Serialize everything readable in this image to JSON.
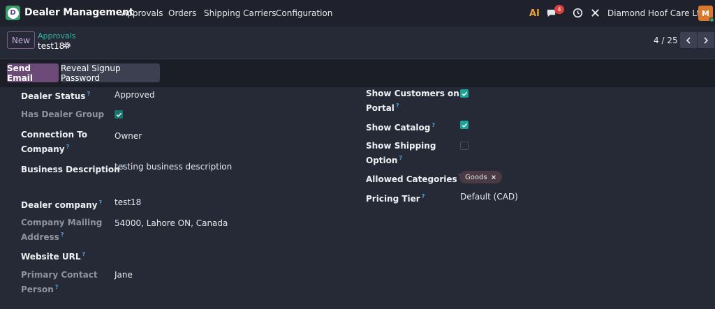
{
  "topbar": {
    "app_title": "Dealer Management",
    "logo_letter": "D",
    "menu": [
      {
        "label": "Approvals"
      },
      {
        "label": "Orders"
      },
      {
        "label": "Shipping Carriers"
      },
      {
        "label": "Configuration"
      }
    ],
    "ai_label": "AI",
    "chat_count": "4",
    "company": "Diamond Hoof Care Ltd",
    "avatar_letter": "M"
  },
  "control": {
    "new_label": "New",
    "breadcrumb_parent": "Approvals",
    "breadcrumb_current": "test18",
    "pager": "4 / 25"
  },
  "actions": {
    "send_email": "Send Email",
    "reveal_password": "Reveal Signup Password"
  },
  "form": {
    "dealer_status": {
      "label": "Dealer Status",
      "value": "Approved"
    },
    "has_dealer_group": {
      "label": "Has Dealer Group",
      "checked": true
    },
    "connection_to_company": {
      "label_1": "Connection To",
      "label_2": "Company",
      "value": "Owner"
    },
    "business_description": {
      "label": "Business Description",
      "value": "testing business description"
    },
    "dealer_company": {
      "label": "Dealer company",
      "value": "test18"
    },
    "company_mailing_address": {
      "label_1": "Company Mailing",
      "label_2": "Address",
      "value": "54000, Lahore ON, Canada"
    },
    "website_url": {
      "label": "Website URL",
      "value": ""
    },
    "primary_contact_person": {
      "label_1": "Primary Contact",
      "label_2": "Person",
      "value": "Jane"
    },
    "show_customers_on_portal": {
      "label_1": "Show Customers on",
      "label_2": "Portal",
      "checked": true
    },
    "show_catalog": {
      "label": "Show Catalog",
      "checked": true
    },
    "show_shipping_option": {
      "label_1": "Show Shipping",
      "label_2": "Option",
      "checked": false
    },
    "allowed_categories": {
      "label": "Allowed Categories",
      "tags": [
        "Goods"
      ]
    },
    "pricing_tier": {
      "label": "Pricing Tier",
      "value": "Default (CAD)"
    },
    "help_mark": "?"
  },
  "colors": {
    "accent_primary": "#6c4a77",
    "accent_teal": "#1aa598",
    "background": "#262a36"
  }
}
